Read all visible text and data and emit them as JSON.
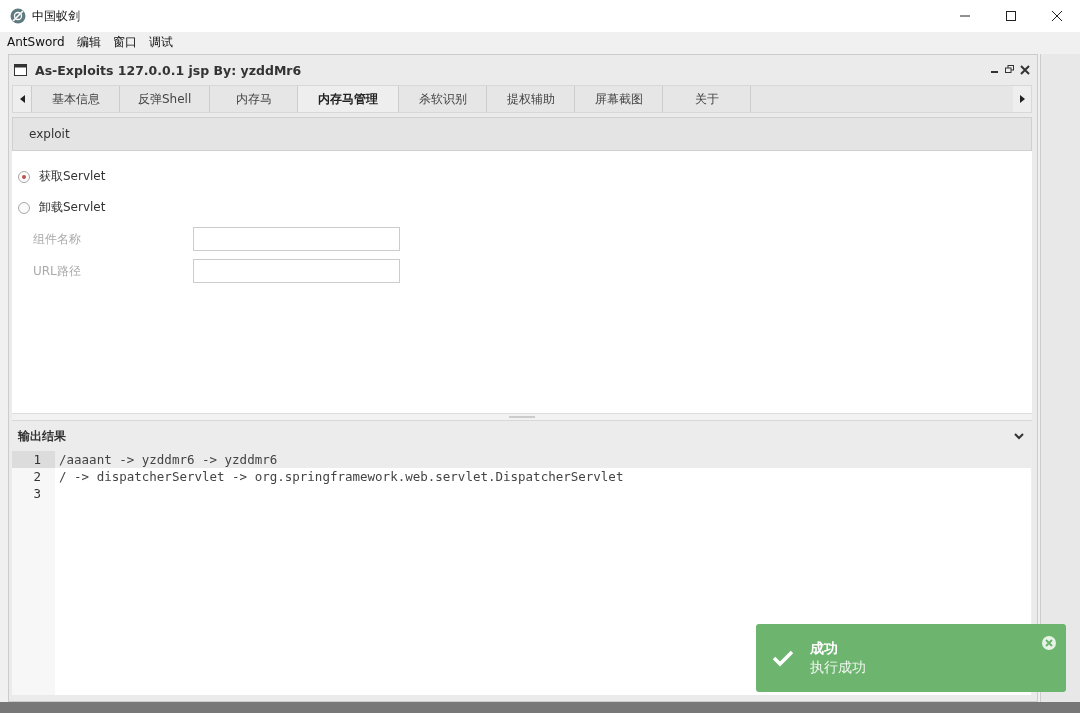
{
  "window": {
    "title": "中国蚁剑"
  },
  "menu": [
    "AntSword",
    "编辑",
    "窗口",
    "调试"
  ],
  "panel": {
    "title": "As-Exploits 127.0.0.1 jsp By: yzddMr6",
    "tabs": [
      {
        "label": "基本信息",
        "selected": false
      },
      {
        "label": "反弹Shell",
        "selected": false
      },
      {
        "label": "内存马",
        "selected": false
      },
      {
        "label": "内存马管理",
        "selected": true
      },
      {
        "label": "杀软识别",
        "selected": false
      },
      {
        "label": "提权辅助",
        "selected": false
      },
      {
        "label": "屏幕截图",
        "selected": false
      },
      {
        "label": "关于",
        "selected": false
      }
    ],
    "toolbar": {
      "button": "exploit"
    },
    "options": [
      {
        "label": "获取Servlet",
        "selected": true
      },
      {
        "label": "卸载Servlet",
        "selected": false
      }
    ],
    "fields": [
      {
        "label": "组件名称"
      },
      {
        "label": "URL路径"
      }
    ]
  },
  "output": {
    "title": "输出结果",
    "lines": [
      {
        "number": "1",
        "text": "/aaaant -> yzddmr6 -> yzddmr6",
        "current": true
      },
      {
        "number": "2",
        "text": "/ -> dispatcherServlet -> org.springframework.web.servlet.DispatcherServlet",
        "current": false
      },
      {
        "number": "3",
        "current": false
      }
    ]
  },
  "toast": {
    "title": "成功",
    "message": "执行成功"
  }
}
